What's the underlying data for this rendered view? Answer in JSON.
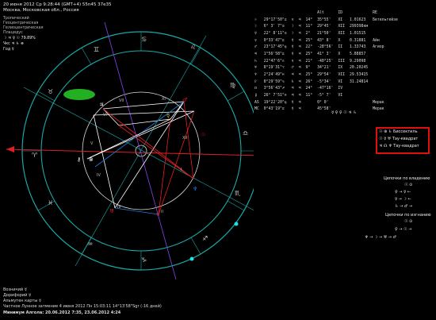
{
  "header": {
    "line1": "20 июня 2012  Ср   9:28:44 (GMT+4) 55n45  37e35",
    "line2": "Москва, Московская обл., Россия"
  },
  "left_labels": [
    "Тропический",
    "Геоцентрическая",
    "Гелиоцентрическая",
    "Плацидус"
  ],
  "left_values": [
    "☽ ♃ ♀ ☉ 79.89%",
    "Чкс ♃ ♄ ⊗",
    "Год ☿"
  ],
  "table_columns": [
    "",
    "",
    "",
    "",
    "",
    "Alt",
    "ID",
    "",
    "RE"
  ],
  "planets": [
    {
      "sym": "☉",
      "pos": "29°17'50\"♊",
      "r": "♀",
      "ruler": "♃",
      "alt": "35°55'",
      "h": "14°",
      "hs": "XI",
      "re": "1.01623",
      "rem": "Бетельгейзе"
    },
    {
      "sym": "☽",
      "pos": "6° 3' 7\"♋",
      "r": "☽",
      "ruler": "♃",
      "alt": "29°45'",
      "h": "11°",
      "hs": "XII",
      "re": "299398км",
      "rem": ""
    },
    {
      "sym": "☿",
      "pos": "22° 8'11\"♋",
      "r": "☽",
      "ruler": "♃",
      "alt": "21°50'",
      "h": "2°",
      "hs": "XII",
      "re": "1.01515",
      "rem": ""
    },
    {
      "sym": "♀",
      "pos": "0°33'47\"♊",
      "r": "☿",
      "ruler": "♃",
      "alt": "43° 8'",
      "h": "25°",
      "hs": "X",
      "re": "0.31881",
      "rem": "Айн"
    },
    {
      "sym": "♂",
      "pos": "23°17'45\"♍",
      "r": "☿",
      "ruler": "♃",
      "alt": "-28°56'",
      "h": "22°",
      "hs": "II",
      "re": "1.33743",
      "rem": "Агиор"
    },
    {
      "sym": "♃",
      "pos": "1°56'58\"♊",
      "r": "☿",
      "ruler": "♃",
      "alt": "41° 3'",
      "h": "25°",
      "hs": "X",
      "re": "5.88857",
      "rem": ""
    },
    {
      "sym": "♄",
      "pos": "22°47'6\"♎",
      "r": "♀",
      "ruler": "♃",
      "alt": "-40°25'",
      "h": "21°",
      "hs": "III",
      "re": "9.29098",
      "rem": ""
    },
    {
      "sym": "♅",
      "pos": "8°19'31\"♈",
      "r": "♂",
      "ruler": "♃",
      "alt": "34°21'",
      "h": "9°",
      "hs": "IX",
      "re": "20.20245",
      "rem": ""
    },
    {
      "sym": "♆",
      "pos": "2°24'49\"♓",
      "r": "♃",
      "ruler": "♃",
      "alt": "29°54'",
      "h": "25°",
      "hs": "VII",
      "re": "29.53415",
      "rem": ""
    },
    {
      "sym": "♇",
      "pos": "8°29'59\"♑",
      "r": "♄",
      "ruler": "♃",
      "alt": "-5°34'",
      "h": "26°",
      "hs": "VI",
      "re": "31.24814",
      "rem": ""
    },
    {
      "sym": "☊",
      "pos": "3°56'43\"♐",
      "r": "♃",
      "ruler": "♃",
      "alt": "-47°16'",
      "h": "24°",
      "hs": "IV",
      "re": "",
      "rem": ""
    },
    {
      "sym": "⚷",
      "pos": "26° 7'51\"♓",
      "r": "♃",
      "ruler": "♃",
      "alt": "-5° 7'",
      "h": "11°",
      "hs": "VI",
      "re": "",
      "rem": ""
    },
    {
      "sym": "AS",
      "pos": "19°22'20\"♍",
      "r": "☿",
      "ruler": "♃",
      "alt": "0° 0'",
      "h": "",
      "hs": "",
      "re": "",
      "rem": "Мерак"
    },
    {
      "sym": "MC",
      "pos": "0°43'19\"♊",
      "r": "☿",
      "ruler": "♃",
      "alt": "45°58'",
      "h": "",
      "hs": "",
      "re": "",
      "rem": "Мерак"
    }
  ],
  "aspect_summary": "☿ ♀  ♀ ☉  ♃ ♄",
  "aspects": [
    {
      "glyphs": "☉ ⊕ ♄",
      "label": "Биссектиль"
    },
    {
      "glyphs": "☉ ☿ ♅",
      "label": "Тау-квадрат"
    },
    {
      "glyphs": "♃ ☊ ♆",
      "label": "Тау-квадрат"
    }
  ],
  "dispositor_title": "Цепочки по владению",
  "dispositor_items": [
    "☉ ⊙",
    "♀ → ☿ ←",
    "☿ → ☽ ←",
    "♄ → ♂ →"
  ],
  "exalt_title": "Цепочки по изгнанию",
  "exalt_items": [
    "☉ ⊙",
    "♀ → ☉ →",
    "♆ → ☽ → ♅ → ♂"
  ],
  "footer": {
    "line1": "Возничий ☿",
    "line2": "Дорифорий ☿",
    "line3": "Альмутен карты ☿",
    "line4": "Частное Лунное затмение 4 июня 2012 Пн 15:03:11 14°13'58\"Sgr (-16 дней)",
    "line5": "Минимум Алгола: 20.06.2012  7:35,  23.06.2012  4:24"
  },
  "colors": {
    "fire": "#e02020",
    "earth": "#22b022",
    "air": "#e0c020",
    "water": "#2080e0",
    "aspect_box": "#e01010"
  }
}
